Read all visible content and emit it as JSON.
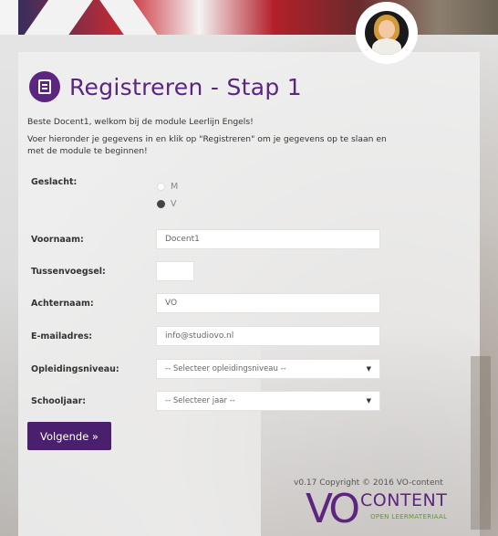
{
  "page": {
    "title": "Registreren - Stap 1",
    "intro_line1": "Beste Docent1, welkom bij de module Leerlijn Engels!",
    "intro_line2": "Voer hieronder je gegevens in en klik op \"Registreren\" om je gegevens op te slaan en met de module te beginnen!"
  },
  "form": {
    "gender_label": "Geslacht:",
    "gender_options": [
      "M",
      "V"
    ],
    "gender_selected": "V",
    "firstname_label": "Voornaam:",
    "firstname_value": "Docent1",
    "infix_label": "Tussenvoegsel:",
    "infix_value": "",
    "lastname_label": "Achternaam:",
    "lastname_value": "VO",
    "email_label": "E-mailadres:",
    "email_value": "info@studiovo.nl",
    "level_label": "Opleidingsniveau:",
    "level_selected": "-- Selecteer opleidingsniveau --",
    "year_label": "Schooljaar:",
    "year_selected": "-- Selecteer jaar --",
    "next_button": "Volgende »"
  },
  "footer": {
    "copyright": "v0.17 Copyright © 2016 VO-content",
    "logo_vo": "VO",
    "logo_content": "CONTENT",
    "logo_sub": "OPEN LEERMATERIAAL"
  },
  "colors": {
    "brand_purple": "#5b2580",
    "button_purple": "#4a1f6e",
    "logo_green": "#5b9a2a"
  },
  "icons": {
    "title": "register-form-icon",
    "select_arrow": "chevron-down-icon"
  }
}
